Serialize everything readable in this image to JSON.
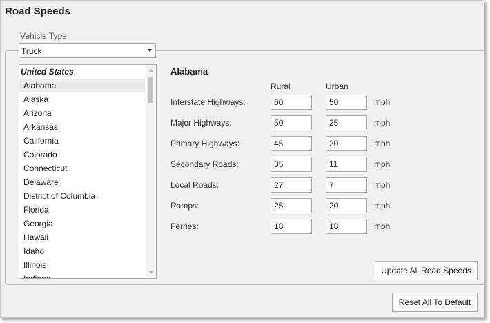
{
  "window": {
    "title": "Road Speeds"
  },
  "vehicle_type": {
    "label": "Vehicle Type",
    "selected": "Truck"
  },
  "state_list": {
    "header": "United States",
    "items": [
      "Alabama",
      "Alaska",
      "Arizona",
      "Arkansas",
      "California",
      "Colorado",
      "Connecticut",
      "Delaware",
      "District of Columbia",
      "Florida",
      "Georgia",
      "Hawaii",
      "Idaho",
      "Illinois",
      "Indiana"
    ],
    "selected": "Alabama"
  },
  "speeds": {
    "state_title": "Alabama",
    "rural_label": "Rural",
    "urban_label": "Urban",
    "unit": "mph",
    "rows": [
      {
        "label": "Interstate Highways:",
        "rural": "60",
        "urban": "50"
      },
      {
        "label": "Major Highways:",
        "rural": "50",
        "urban": "25"
      },
      {
        "label": "Primary Highways:",
        "rural": "45",
        "urban": "20"
      },
      {
        "label": "Secondary Roads:",
        "rural": "35",
        "urban": "11"
      },
      {
        "label": "Local Roads:",
        "rural": "27",
        "urban": "7"
      },
      {
        "label": "Ramps:",
        "rural": "25",
        "urban": "20"
      },
      {
        "label": "Ferries:",
        "rural": "18",
        "urban": "18"
      }
    ]
  },
  "buttons": {
    "update_all": "Update All Road Speeds",
    "reset_all": "Reset All To Default"
  }
}
